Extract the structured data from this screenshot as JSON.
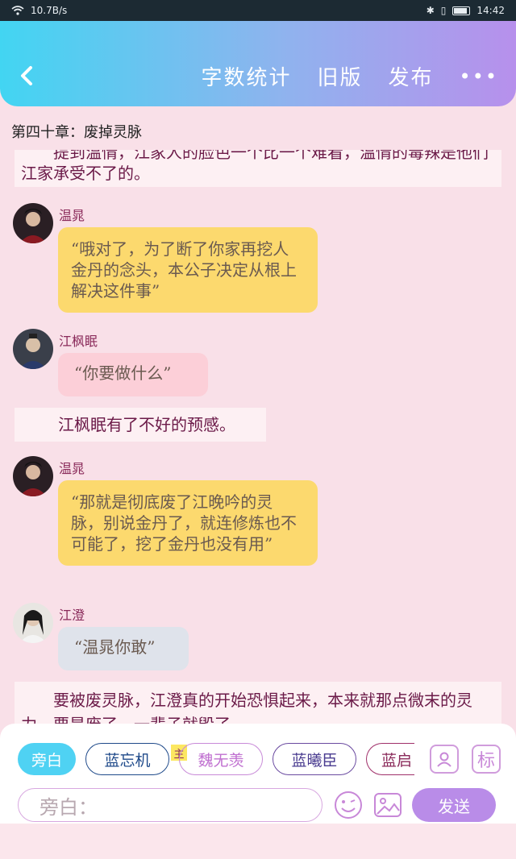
{
  "status_bar": {
    "speed": "10.7B/s",
    "time": "14:42"
  },
  "header": {
    "actions": [
      "字数统计",
      "旧版",
      "发布"
    ],
    "more": "•••"
  },
  "chapter_title": "第四十章：废掉灵脉",
  "messages": [
    {
      "type": "narration",
      "text": "提到温情，江家人的脸色一个比一个难看，温情的毒辣是他们江家承受不了的。"
    },
    {
      "type": "dialog",
      "name": "温晁",
      "text": "“哦对了，为了断了你家再挖人金丹的念头，本公子决定从根上解决这件事”",
      "color": "yellow"
    },
    {
      "type": "dialog",
      "name": "江枫眠",
      "text": "“你要做什么”",
      "color": "pink"
    },
    {
      "type": "narration",
      "text": "江枫眠有了不好的预感。"
    },
    {
      "type": "dialog",
      "name": "温晁",
      "text": "“那就是彻底废了江晚吟的灵脉，别说金丹了，就连修炼也不可能了，挖了金丹也没有用”",
      "color": "yellow"
    },
    {
      "type": "dialog",
      "name": "江澄",
      "text": "“温晁你敢”",
      "color": "gray"
    },
    {
      "type": "narration",
      "text": "要被废灵脉，江澄真的开始恐惧起来，本来就那点微末的灵力，要是废了，一辈子就毁了。"
    }
  ],
  "characters": [
    "旁白",
    "蓝忘机",
    "魏无羡",
    "蓝曦臣",
    "蓝启"
  ],
  "main_badge": "主",
  "tools": {
    "avatar_icon": "person-card-icon",
    "tag_label": "标"
  },
  "input": {
    "placeholder": "旁白："
  },
  "send_label": "发送",
  "colors": {
    "accent": "#4fd2f3",
    "send": "#b98ce8",
    "bubble_yellow": "#fcd96e",
    "bubble_pink": "#fccfd8",
    "bubble_gray": "#dfe3eb"
  }
}
